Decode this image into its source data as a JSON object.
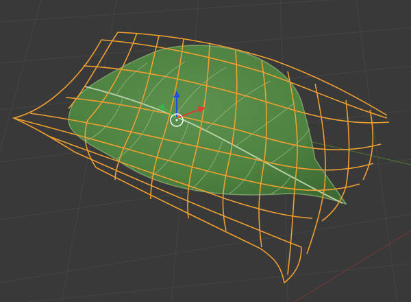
{
  "viewport": {
    "background_color": "#393939",
    "grid_color": "#444444",
    "axis_x_color": "#8a3a3a",
    "axis_y_color": "#4a7a2a"
  },
  "lattice": {
    "color": "#f0a030",
    "selected": true
  },
  "leaf_object": {
    "fill_color": "#4e8240",
    "edge_color": "#6f9a5c",
    "vein_color": "#a9c49a"
  },
  "transform_gizmo": {
    "x_axis_color": "#e53935",
    "y_axis_color": "#39b54a",
    "z_axis_color": "#2050e0",
    "pivot_ring_color": "#ffffff",
    "pivot_ring_color_alt": "#f5e6a0"
  }
}
